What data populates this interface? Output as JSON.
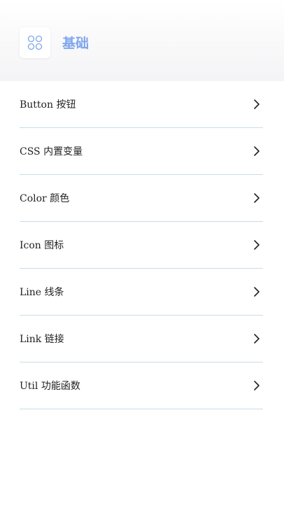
{
  "header": {
    "title": "基础",
    "icon": "grid-circles-icon",
    "accent_color": "#7fa6ec"
  },
  "items": [
    {
      "label": "Button 按钮"
    },
    {
      "label": "CSS 内置变量"
    },
    {
      "label": "Color 颜色"
    },
    {
      "label": "Icon 图标"
    },
    {
      "label": "Line 线条"
    },
    {
      "label": "Link 链接"
    },
    {
      "label": "Util 功能函数"
    }
  ],
  "colors": {
    "divider": "#c9dde5",
    "text": "#222222"
  }
}
